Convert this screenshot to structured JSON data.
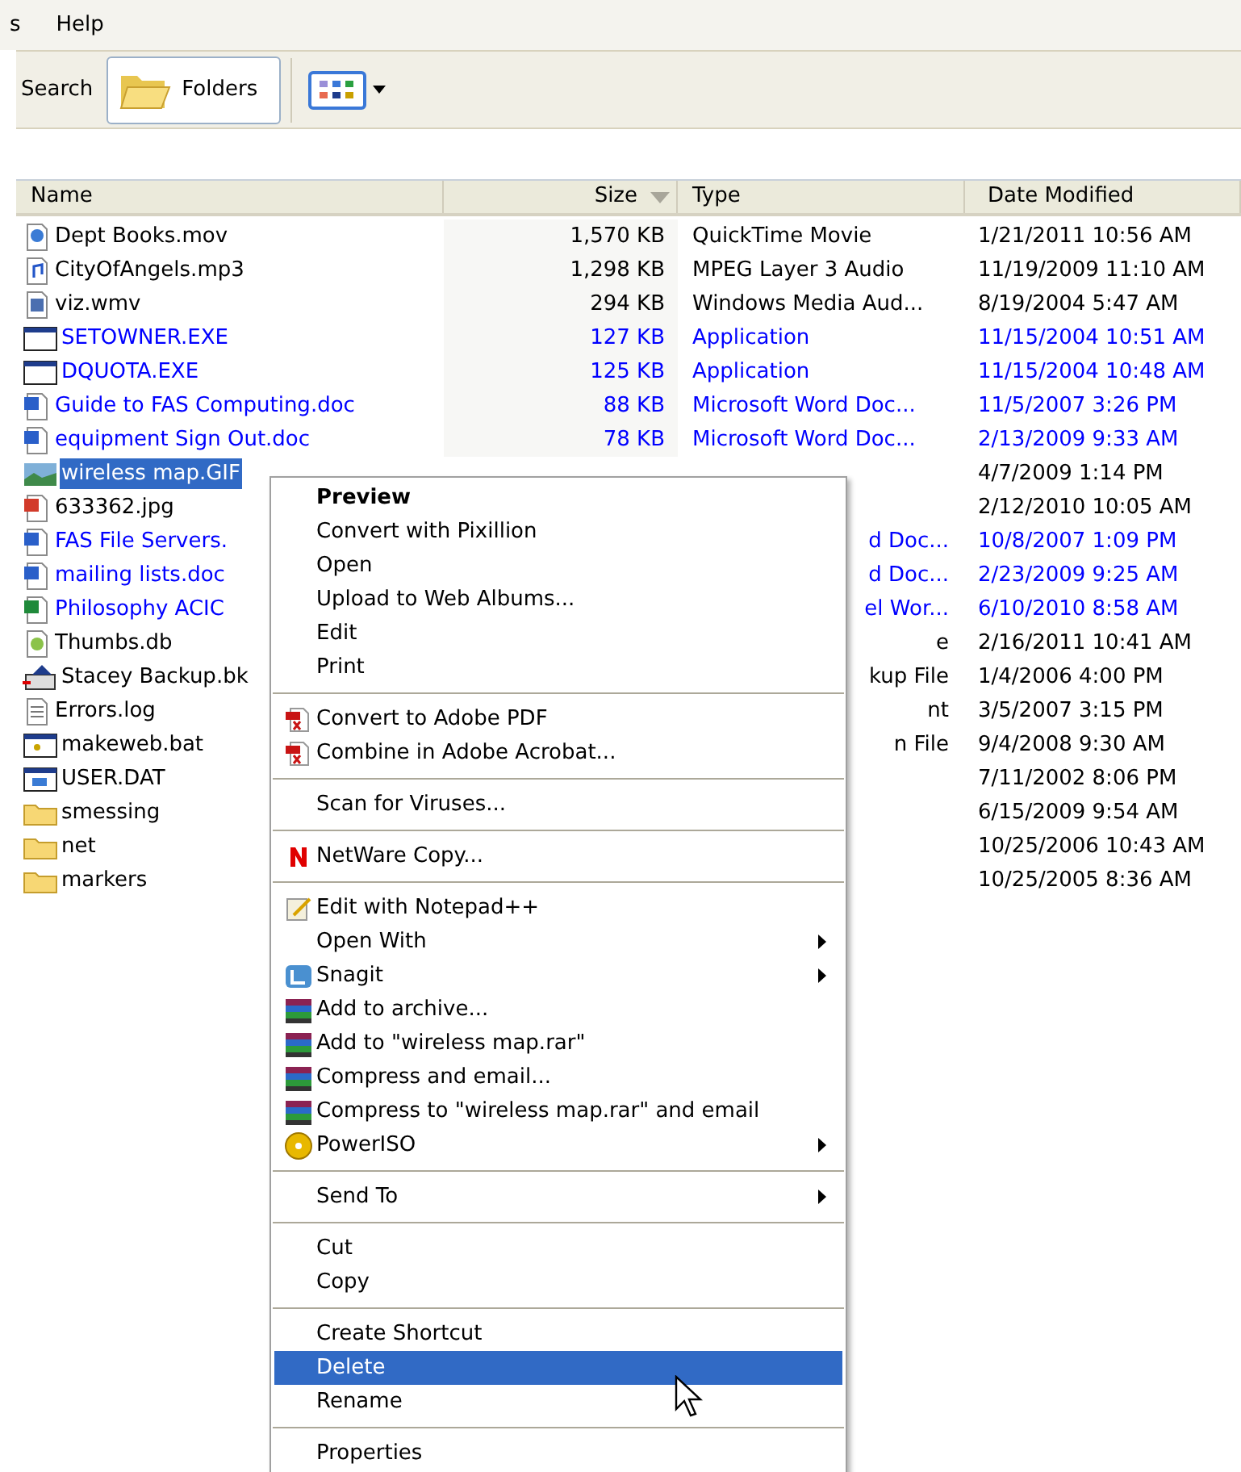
{
  "menu_bar": [
    {
      "label": "s"
    },
    {
      "label": "Help"
    }
  ],
  "toolbar": {
    "search": "Search",
    "folders": {
      "label": "Folders",
      "pressed": true
    }
  },
  "columns": [
    {
      "label": "Name",
      "sorted": false
    },
    {
      "label": "Size",
      "sorted": true
    },
    {
      "label": "Type",
      "sorted": false
    },
    {
      "label": "Date Modified",
      "sorted": false
    }
  ],
  "rows": [
    {
      "kind": "movie",
      "name": "Dept Books.mov",
      "size": "1,570 KB",
      "type": "QuickTime Movie",
      "date": "1/21/2011 10:56 AM",
      "compressed": false,
      "selected": false
    },
    {
      "kind": "audio",
      "name": "CityOfAngels.mp3",
      "size": "1,298 KB",
      "type": "MPEG Layer 3 Audio",
      "date": "11/19/2009 11:10 AM",
      "compressed": false,
      "selected": false
    },
    {
      "kind": "video",
      "name": "viz.wmv",
      "size": "294 KB",
      "type": "Windows Media Aud...",
      "date": "8/19/2004 5:47 AM",
      "compressed": false,
      "selected": false
    },
    {
      "kind": "exe",
      "name": "SETOWNER.EXE",
      "size": "127 KB",
      "type": "Application",
      "date": "11/15/2004 10:51 AM",
      "compressed": true,
      "selected": false
    },
    {
      "kind": "exe",
      "name": "DQUOTA.EXE",
      "size": "125 KB",
      "type": "Application",
      "date": "11/15/2004 10:48 AM",
      "compressed": true,
      "selected": false
    },
    {
      "kind": "word",
      "name": "Guide to FAS Computing.doc",
      "size": "88 KB",
      "type": "Microsoft Word Doc...",
      "date": "11/5/2007 3:26 PM",
      "compressed": true,
      "selected": false
    },
    {
      "kind": "word",
      "name": "equipment Sign Out.doc",
      "size": "78 KB",
      "type": "Microsoft Word Doc...",
      "date": "2/13/2009 9:33 AM",
      "compressed": true,
      "selected": false
    },
    {
      "kind": "image",
      "name": "wireless map.GIF",
      "date": "4/7/2009 1:14 PM",
      "compressed": false,
      "selected": true
    },
    {
      "kind": "jpg",
      "name": "633362.jpg",
      "date": "2/12/2010 10:05 AM",
      "compressed": false,
      "selected": false
    },
    {
      "kind": "word",
      "name": "FAS File Servers.",
      "type_fragment": "d Doc...",
      "date": "10/8/2007 1:09 PM",
      "compressed": true,
      "selected": false
    },
    {
      "kind": "word",
      "name": "mailing lists.doc",
      "type_fragment": "d Doc...",
      "date": "2/23/2009 9:25 AM",
      "compressed": true,
      "selected": false
    },
    {
      "kind": "excel",
      "name": "Philosophy ACIC",
      "type_fragment": "el Wor...",
      "date": "6/10/2010 8:58 AM",
      "compressed": true,
      "selected": false
    },
    {
      "kind": "db",
      "name": "Thumbs.db",
      "type_fragment": "e",
      "date": "2/16/2011 10:41 AM",
      "compressed": false,
      "selected": false
    },
    {
      "kind": "backup",
      "name": "Stacey Backup.bk",
      "type_fragment": "kup File",
      "date": "1/4/2006 4:00 PM",
      "compressed": false,
      "selected": false
    },
    {
      "kind": "log",
      "name": "Errors.log",
      "type_fragment": "nt",
      "date": "3/5/2007 3:15 PM",
      "compressed": false,
      "selected": false
    },
    {
      "kind": "bat",
      "name": "makeweb.bat",
      "type_fragment": "n File",
      "date": "9/4/2008 9:30 AM",
      "compressed": false,
      "selected": false
    },
    {
      "kind": "dat",
      "name": "USER.DAT",
      "date": "7/11/2002 8:06 PM",
      "compressed": false,
      "selected": false
    },
    {
      "kind": "folder",
      "name": "smessing",
      "date": "6/15/2009 9:54 AM",
      "compressed": false,
      "selected": false
    },
    {
      "kind": "folder",
      "name": "net",
      "date": "10/25/2006 10:43 AM",
      "compressed": false,
      "selected": false
    },
    {
      "kind": "folder",
      "name": "markers",
      "date": "10/25/2005 8:36 AM",
      "compressed": false,
      "selected": false
    }
  ],
  "context_menu": [
    {
      "kind": "plain",
      "label": "Preview",
      "default": true,
      "submenu": false,
      "selected": false
    },
    {
      "kind": "plain",
      "label": "Convert with Pixillion",
      "default": false,
      "submenu": false,
      "selected": false
    },
    {
      "kind": "plain",
      "label": "Open",
      "default": false,
      "submenu": false,
      "selected": false
    },
    {
      "kind": "plain",
      "label": "Upload to Web Albums...",
      "default": false,
      "submenu": false,
      "selected": false
    },
    {
      "kind": "plain",
      "label": "Edit",
      "default": false,
      "submenu": false,
      "selected": false
    },
    {
      "kind": "plain",
      "label": "Print",
      "default": false,
      "submenu": false,
      "selected": false
    },
    {
      "kind": "separator"
    },
    {
      "kind": "pdf",
      "label": "Convert to Adobe PDF",
      "default": false,
      "submenu": false,
      "selected": false
    },
    {
      "kind": "pdf",
      "label": "Combine in Adobe Acrobat...",
      "default": false,
      "submenu": false,
      "selected": false
    },
    {
      "kind": "separator"
    },
    {
      "kind": "plain",
      "label": "Scan for Viruses...",
      "default": false,
      "submenu": false,
      "selected": false
    },
    {
      "kind": "separator"
    },
    {
      "kind": "netware",
      "label": "NetWare Copy...",
      "default": false,
      "submenu": false,
      "selected": false
    },
    {
      "kind": "separator"
    },
    {
      "kind": "notepad",
      "label": "Edit with Notepad++",
      "default": false,
      "submenu": false,
      "selected": false
    },
    {
      "kind": "plain",
      "label": "Open With",
      "default": false,
      "submenu": true,
      "selected": false
    },
    {
      "kind": "snagit",
      "label": "Snagit",
      "default": false,
      "submenu": true,
      "selected": false
    },
    {
      "kind": "rar",
      "label": "Add to archive...",
      "default": false,
      "submenu": false,
      "selected": false
    },
    {
      "kind": "rar",
      "label": "Add to \"wireless map.rar\"",
      "default": false,
      "submenu": false,
      "selected": false
    },
    {
      "kind": "rar",
      "label": "Compress and email...",
      "default": false,
      "submenu": false,
      "selected": false
    },
    {
      "kind": "rar",
      "label": "Compress to \"wireless map.rar\" and email",
      "default": false,
      "submenu": false,
      "selected": false
    },
    {
      "kind": "poweriso",
      "label": "PowerISO",
      "default": false,
      "submenu": true,
      "selected": false
    },
    {
      "kind": "separator"
    },
    {
      "kind": "plain",
      "label": "Send To",
      "default": false,
      "submenu": true,
      "selected": false
    },
    {
      "kind": "separator"
    },
    {
      "kind": "plain",
      "label": "Cut",
      "default": false,
      "submenu": false,
      "selected": false
    },
    {
      "kind": "plain",
      "label": "Copy",
      "default": false,
      "submenu": false,
      "selected": false
    },
    {
      "kind": "separator"
    },
    {
      "kind": "plain",
      "label": "Create Shortcut",
      "default": false,
      "submenu": false,
      "selected": false
    },
    {
      "kind": "plain",
      "label": "Delete",
      "default": false,
      "submenu": false,
      "selected": true
    },
    {
      "kind": "plain",
      "label": "Rename",
      "default": false,
      "submenu": false,
      "selected": false
    },
    {
      "kind": "separator"
    },
    {
      "kind": "plain",
      "label": "Properties",
      "default": false,
      "submenu": false,
      "selected": false
    }
  ]
}
